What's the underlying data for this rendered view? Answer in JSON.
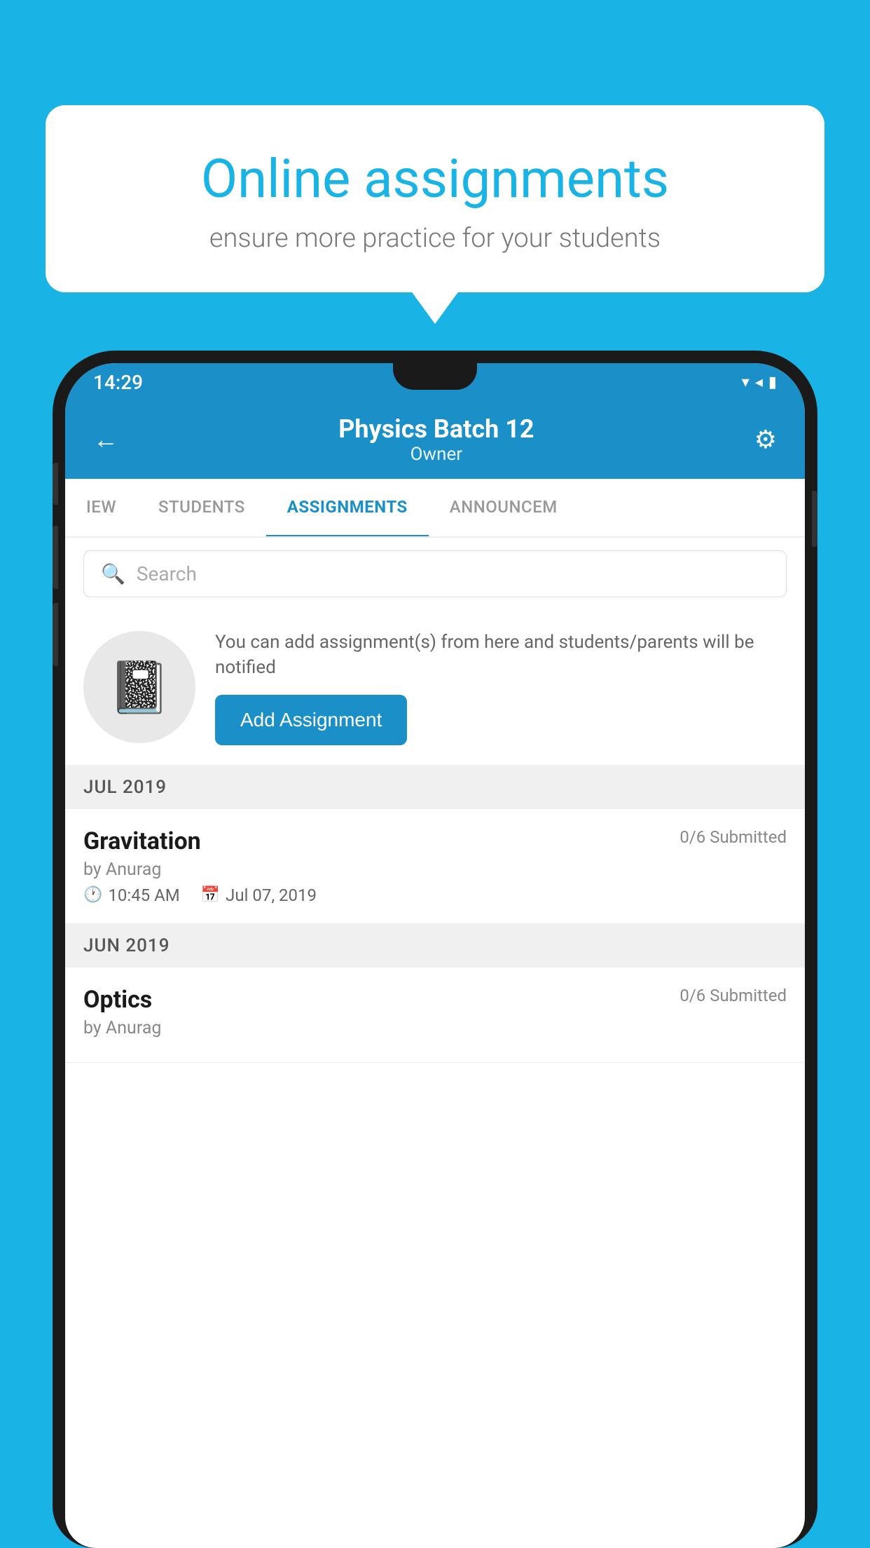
{
  "background": {
    "color": "#1ab3e6"
  },
  "speech_bubble": {
    "title": "Online assignments",
    "subtitle": "ensure more practice for your students"
  },
  "phone": {
    "status_bar": {
      "time": "14:29",
      "icons": "▾◂▮"
    },
    "header": {
      "title": "Physics Batch 12",
      "subtitle": "Owner",
      "back_label": "←",
      "gear_label": "⚙"
    },
    "tabs": [
      {
        "label": "IEW",
        "active": false
      },
      {
        "label": "STUDENTS",
        "active": false
      },
      {
        "label": "ASSIGNMENTS",
        "active": true
      },
      {
        "label": "ANNOUNCEM",
        "active": false
      }
    ],
    "search": {
      "placeholder": "Search"
    },
    "add_assignment_section": {
      "description": "You can add assignment(s) from here and students/parents will be notified",
      "button_label": "Add Assignment"
    },
    "months": [
      {
        "label": "JUL 2019",
        "assignments": [
          {
            "name": "Gravitation",
            "submitted": "0/6 Submitted",
            "by": "by Anurag",
            "time": "10:45 AM",
            "date": "Jul 07, 2019"
          }
        ]
      },
      {
        "label": "JUN 2019",
        "assignments": [
          {
            "name": "Optics",
            "submitted": "0/6 Submitted",
            "by": "by Anurag",
            "time": "",
            "date": ""
          }
        ]
      }
    ]
  }
}
